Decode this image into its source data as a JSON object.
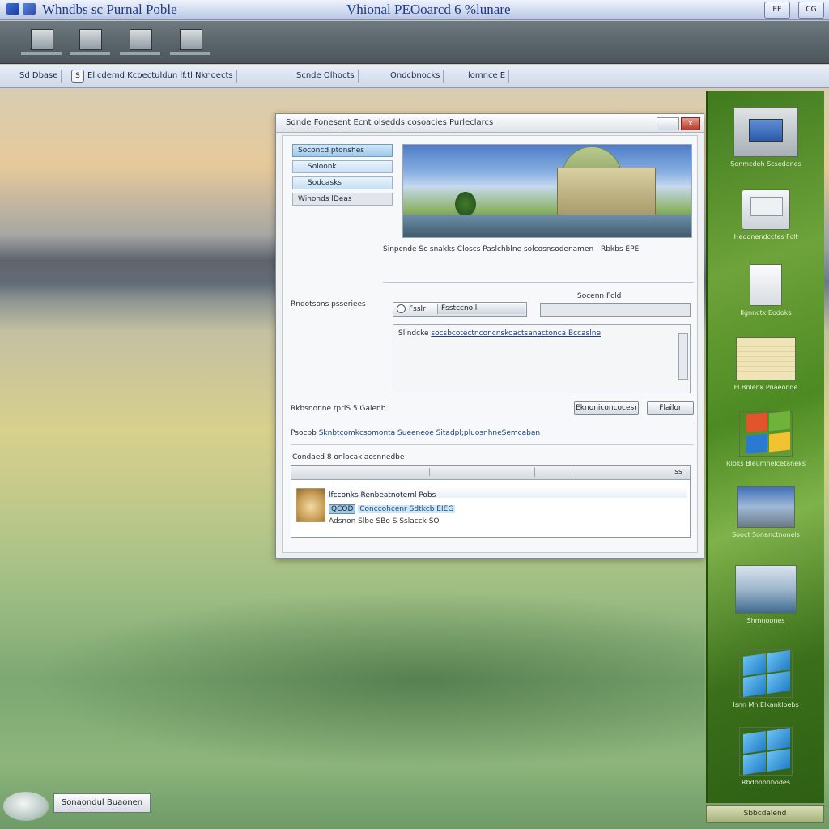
{
  "window": {
    "title_left": "Whndbs sc Purnal Poble",
    "title_center": "Vhional PEOoarcd 6 %lunare",
    "btn1": "EE",
    "btn2": "CG"
  },
  "navbar": {
    "items": [
      "Sd Dbase",
      "Ellcdemd Kcbectuldun lf.tl Nknoects",
      "Scnde Olhocts",
      "Ondcbnocks",
      "lomnce E"
    ],
    "icon_label": "S"
  },
  "dialog": {
    "title": "Sdnde Fonesent Ecnt olsedds cosoacies Purleclarcs",
    "close_label": "x",
    "sidenav": [
      "Soconcd ptonshes",
      "Soloonk",
      "Sodcasks",
      "Winonds lDeas"
    ],
    "caption": "Sinpcnde Sc snakks Closcs Paslchblne solcosnsodenamen | Rbkbs EPE",
    "size_label": "Socenn Fcld",
    "settings_label": "Rndotsons psseriees",
    "combo_left": "Fsslr",
    "combo_right": "Fsstccnoll",
    "text_line_prefix": "Slindcke",
    "text_line_link": "socsbcotectnconcnskoactsanactonca Bccaslne",
    "option_label": "Rkbsnonne tpriS 5 Galenb",
    "btn_primary": "Eknoniconcocesr",
    "btn_secondary": "Flailor",
    "link_line_prefix": "Psocbb",
    "link_line_link": "Sknbtcomkcsomonta Sueeneoe Sitadpl;pluosnhneSemcaban",
    "group_label": "Condaed 8 onlocaklaosnnedbe",
    "list_header_right": "ss",
    "row1": "lfcconks Renbeatnoteml Pobs",
    "row2_tag": "QCOD",
    "row2_sel": "Conccohcenr Sdtkcb EIEG",
    "row3": "Adsnon   Slbe SBo   S  Sslacck SO"
  },
  "sidebar": {
    "items": [
      "Sonmcdeh Scsedanes",
      "Hedonendcctes Fclt",
      "Ilgnnctk Eodoks",
      "Fl Bnlenk Pnaeonde",
      "Rloks Bleumnelcetaneks",
      "Sooct Sonanctnonels",
      "Shmnoones",
      "Isnn Mh Elkankloebs",
      "Rbdbnonbodes"
    ],
    "footer": "Sbbcdalend"
  },
  "taskbar": {
    "start_button": "Sonaondul Buaonen"
  }
}
